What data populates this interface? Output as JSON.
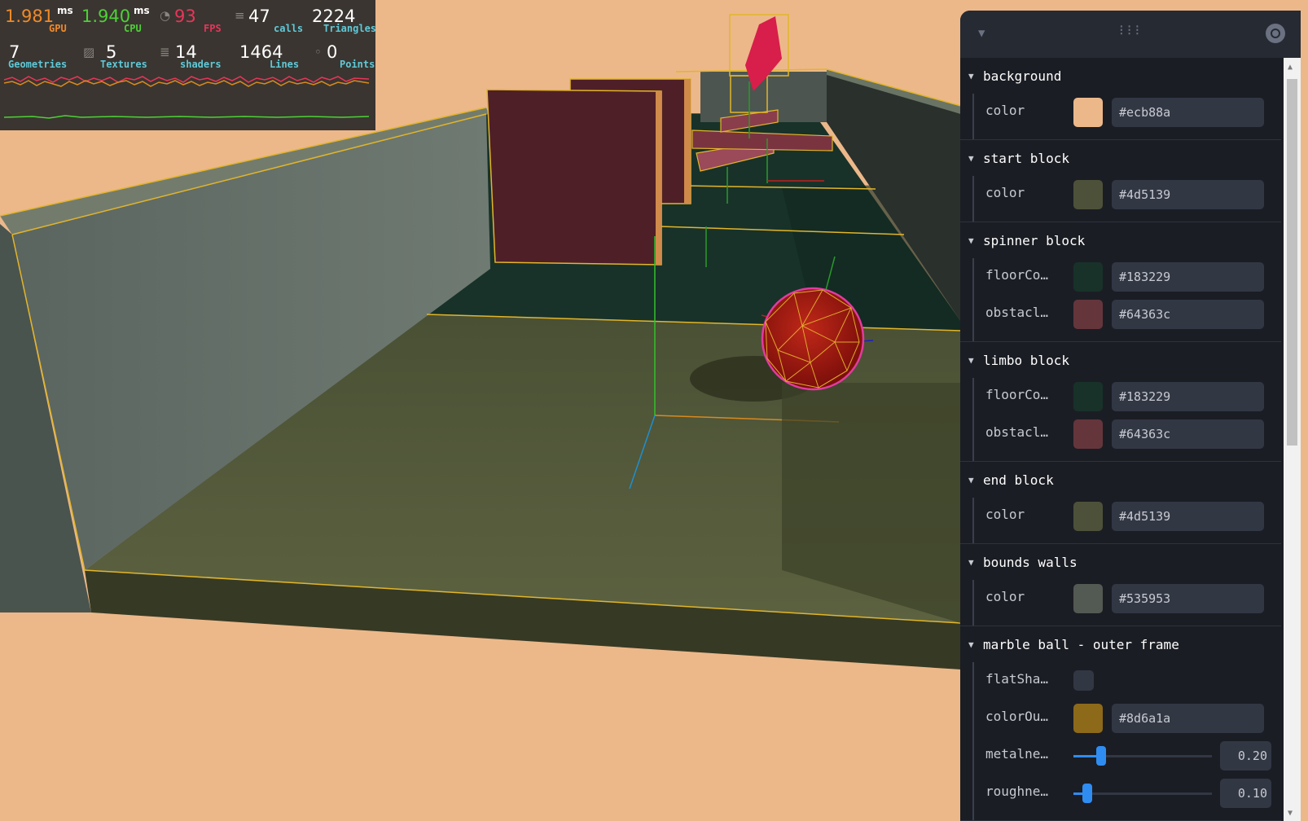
{
  "perf": {
    "gpu_value": "1.981",
    "gpu_unit": "ms",
    "gpu_label": "GPU",
    "cpu_value": "1.940",
    "cpu_unit": "ms",
    "cpu_label": "CPU",
    "fps_value": "93",
    "fps_label": "FPS",
    "calls_value": "47",
    "calls_label": "calls",
    "triangles_value": "2224",
    "triangles_label": "Triangles",
    "geometries_value": "7",
    "geometries_label": "Geometries",
    "textures_value": "5",
    "textures_label": "Textures",
    "shaders_value": "14",
    "shaders_label": "shaders",
    "lines_value": "1464",
    "lines_label": "Lines",
    "points_value": "0",
    "points_label": "Points",
    "colors": {
      "gpu": "#f08a2a",
      "cpu": "#4cd137",
      "fps": "#e8355a",
      "label": "#5fc9d8"
    }
  },
  "panel": {
    "header_icons": [
      "chevron-down-icon",
      "drag-handle-icon",
      "search-icon"
    ],
    "folders": [
      {
        "title": "background",
        "rows": [
          {
            "label": "color",
            "swatch": "#ecb88a",
            "value": "#ecb88a"
          }
        ]
      },
      {
        "title": "start block",
        "rows": [
          {
            "label": "color",
            "swatch": "#4d5139",
            "value": "#4d5139"
          }
        ]
      },
      {
        "title": "spinner block",
        "rows": [
          {
            "label": "floorCo…",
            "swatch": "#183229",
            "value": "#183229"
          },
          {
            "label": "obstacl…",
            "swatch": "#64363c",
            "value": "#64363c"
          }
        ]
      },
      {
        "title": "limbo block",
        "rows": [
          {
            "label": "floorCo…",
            "swatch": "#183229",
            "value": "#183229"
          },
          {
            "label": "obstacl…",
            "swatch": "#64363c",
            "value": "#64363c"
          }
        ]
      },
      {
        "title": "end block",
        "rows": [
          {
            "label": "color",
            "swatch": "#4d5139",
            "value": "#4d5139"
          }
        ]
      },
      {
        "title": "bounds walls",
        "rows": [
          {
            "label": "color",
            "swatch": "#535953",
            "value": "#535953"
          }
        ]
      },
      {
        "title": "marble ball - outer frame",
        "rows": [
          {
            "label": "flatSha…",
            "type": "checkbox",
            "checked": false
          },
          {
            "label": "colorOu…",
            "swatch": "#8d6a1a",
            "value": "#8d6a1a"
          },
          {
            "label": "metalne…",
            "type": "slider",
            "value": "0.20",
            "fraction": 0.2
          },
          {
            "label": "roughne…",
            "type": "slider",
            "value": "0.10",
            "fraction": 0.1
          }
        ]
      }
    ]
  }
}
